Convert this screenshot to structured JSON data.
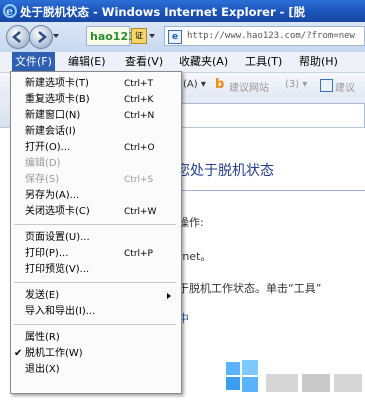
{
  "window": {
    "title": "处于脱机状态 - Windows Internet Explorer - [脱"
  },
  "address_bar": {
    "hao_label": "hao123",
    "cert_label": "证",
    "url": "http://www.hao123.com/?from=new"
  },
  "menubar": {
    "items": [
      "文件(F)",
      "编辑(E)",
      "查看(V)",
      "收藏夹(A)",
      "工具(T)",
      "帮助(H)"
    ]
  },
  "favorites_bar": {
    "item1": "(A) ▾",
    "item2": "建议网站",
    "item3": "(3) ▾",
    "item4": "建议"
  },
  "content": {
    "headline": "因为您处于脱机状态",
    "lines": [
      "操作:",
      "rnet。",
      "于脱机工作状态。单击“工具”",
      "中"
    ]
  },
  "file_menu": {
    "items": [
      {
        "label": "新建选项卡(T)",
        "shortcut": "Ctrl+T",
        "disabled": false
      },
      {
        "label": "重复选项卡(B)",
        "shortcut": "Ctrl+K",
        "disabled": false
      },
      {
        "label": "新建窗口(N)",
        "shortcut": "Ctrl+N",
        "disabled": false
      },
      {
        "label": "新建会话(I)",
        "shortcut": "",
        "disabled": false
      },
      {
        "label": "打开(O)...",
        "shortcut": "Ctrl+O",
        "disabled": false
      },
      {
        "label": "编辑(D)",
        "shortcut": "",
        "disabled": true
      },
      {
        "label": "保存(S)",
        "shortcut": "Ctrl+S",
        "disabled": true
      },
      {
        "label": "另存为(A)...",
        "shortcut": "",
        "disabled": false
      },
      {
        "label": "关闭选项卡(C)",
        "shortcut": "Ctrl+W",
        "disabled": false
      },
      {
        "label": "页面设置(U)...",
        "shortcut": "",
        "disabled": false
      },
      {
        "label": "打印(P)...",
        "shortcut": "Ctrl+P",
        "disabled": false
      },
      {
        "label": "打印预览(V)...",
        "shortcut": "",
        "disabled": false
      },
      {
        "label": "发送(E)",
        "shortcut": "",
        "disabled": false,
        "submenu": true
      },
      {
        "label": "导入和导出(I)...",
        "shortcut": "",
        "disabled": false
      },
      {
        "label": "属性(R)",
        "shortcut": "",
        "disabled": false
      },
      {
        "label": "脱机工作(W)",
        "shortcut": "",
        "disabled": false,
        "checked": true
      },
      {
        "label": "退出(X)",
        "shortcut": "",
        "disabled": false
      }
    ]
  },
  "colors": {
    "titlebar": "#1b53b8",
    "menu_highlight": "#2f5fb3",
    "headline": "#24408e"
  }
}
